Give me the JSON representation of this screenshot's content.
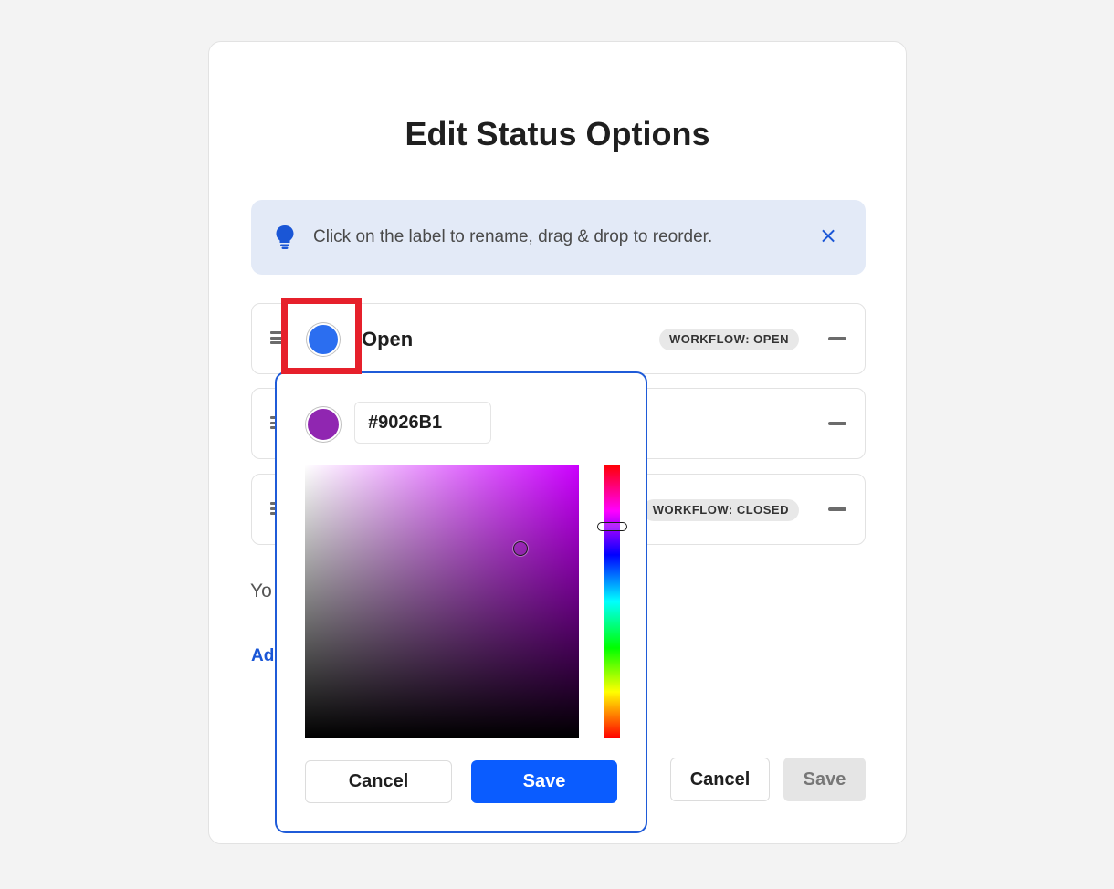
{
  "dialog": {
    "title": "Edit Status Options"
  },
  "info_banner": {
    "icon": "lightbulb-icon",
    "text": "Click on the label to rename, drag & drop to reorder.",
    "close_glyph": "×"
  },
  "status_rows": [
    {
      "label": "Open",
      "color": "#2b6ef0",
      "badge": "WORKFLOW: OPEN"
    },
    {
      "label": "",
      "color": "#9026B1",
      "badge": ""
    },
    {
      "label": "",
      "color": "#2b6ef0",
      "badge": "WORKFLOW: CLOSED"
    }
  ],
  "limit_text": "Yo",
  "add_link": "Ad",
  "footer": {
    "cancel_label": "Cancel",
    "save_label": "Save"
  },
  "color_picker": {
    "hex_value": "#9026B1",
    "swatch_color": "#9026B1",
    "hue_color": "#cc00ff",
    "cancel_label": "Cancel",
    "save_label": "Save"
  },
  "colors": {
    "accent": "#0a5cff",
    "highlight": "#e6202b"
  }
}
